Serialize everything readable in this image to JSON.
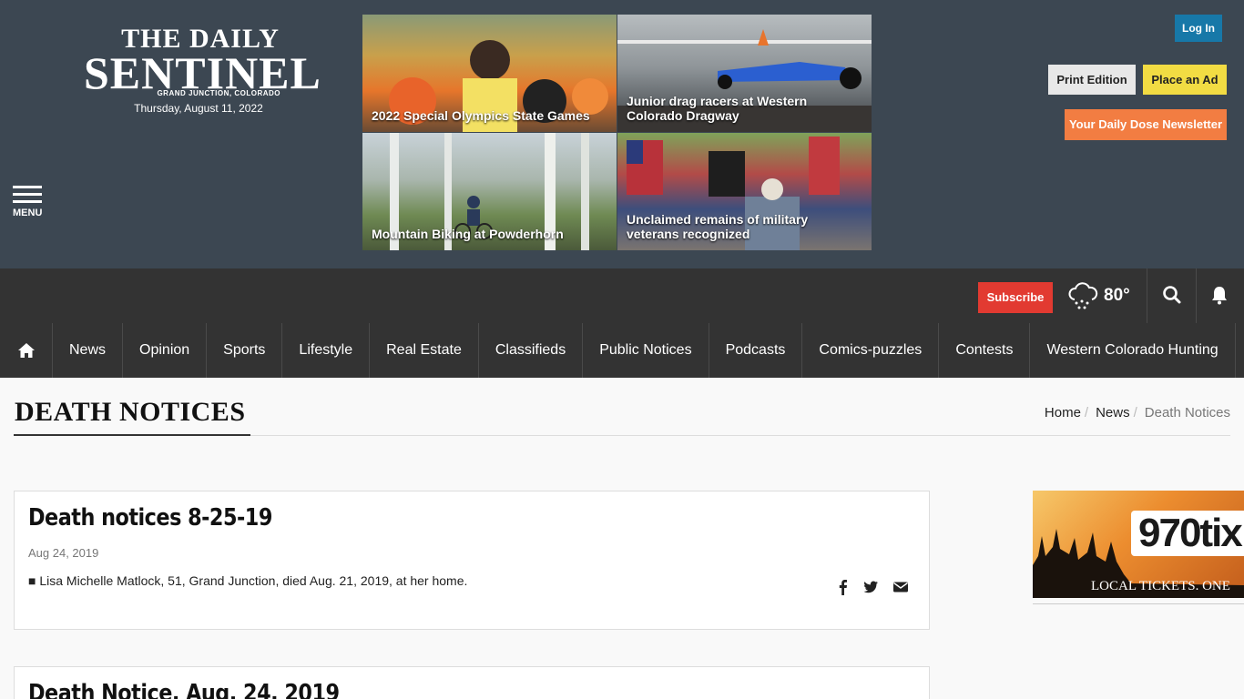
{
  "masthead": {
    "logo_line1": "THE DAILY",
    "logo_line2": "SENTINEL",
    "logo_sub": "GRAND JUNCTION, COLORADO",
    "date": "Thursday, August 11, 2022",
    "menu_label": "MENU",
    "login_label": "Log In",
    "print_label": "Print Edition",
    "ad_label": "Place an Ad",
    "newsletter_label": "Your Daily Dose Newsletter"
  },
  "featured": [
    {
      "caption": "2022 Special Olympics State Games"
    },
    {
      "caption": "Junior drag racers at Western Colorado Dragway"
    },
    {
      "caption": "Mountain Biking at Powderhorn"
    },
    {
      "caption": "Unclaimed remains of military veterans recognized"
    }
  ],
  "utility": {
    "subscribe_label": "Subscribe",
    "temperature": "80°",
    "weather_icon": "snow-cloud-icon"
  },
  "nav": {
    "items": [
      "News",
      "Opinion",
      "Sports",
      "Lifestyle",
      "Real Estate",
      "Classifieds",
      "Public Notices",
      "Podcasts",
      "Comics-puzzles",
      "Contests",
      "Western Colorado Hunting"
    ]
  },
  "page": {
    "title": "DEATH NOTICES",
    "breadcrumb": [
      "Home",
      "News",
      "Death Notices"
    ]
  },
  "articles": [
    {
      "title": "Death notices 8-25-19",
      "date": "Aug 24, 2019",
      "summary": "■ Lisa Michelle Matlock, 51, Grand Junction, died Aug. 21, 2019, at her home."
    },
    {
      "title": "Death Notice, Aug. 24, 2019"
    }
  ],
  "sidebar_ad": {
    "logo": "970tix",
    "tagline": "LOCAL TICKETS. ONE"
  },
  "colors": {
    "masthead_bg": "#3c4752",
    "nav_bg": "#333333",
    "login": "#1778a8",
    "place_ad": "#f2dc43",
    "newsletter": "#f27d42",
    "subscribe": "#e23a31"
  }
}
